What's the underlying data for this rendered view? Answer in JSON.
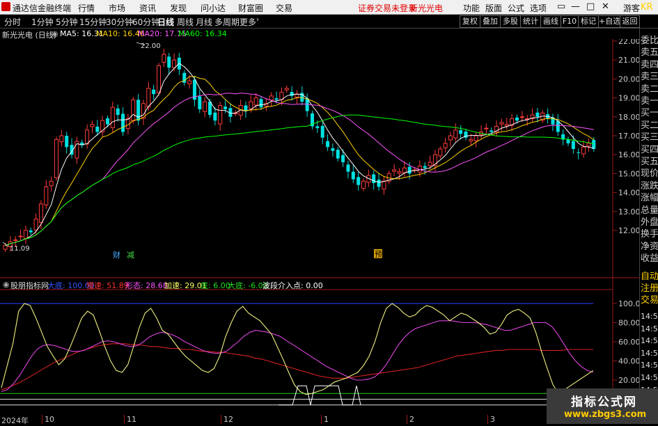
{
  "topbar": {
    "app_title": "通达信金融终端",
    "menus": [
      "行情",
      "市场",
      "资讯",
      "发现",
      "问小达",
      "财富圈",
      "交易"
    ],
    "notice": "证券交易未登录",
    "stock_name": "新光光电",
    "right_menus": [
      "功能",
      "版面",
      "公式",
      "选项"
    ],
    "user": "游客",
    "controls": [
      "▭",
      "—",
      "□",
      "✕"
    ]
  },
  "tabs": {
    "periods": [
      "分时",
      "1分钟",
      "5分钟",
      "15分钟",
      "30分钟",
      "60分钟",
      "日线",
      "周线",
      "月线",
      "多周期",
      "更多"
    ],
    "active": "日线",
    "buttons": [
      "复权",
      "叠加",
      "多股",
      "统计",
      "画线",
      "F10",
      "标记",
      "+自选",
      "返回"
    ]
  },
  "ma_line": {
    "title": "新光光电 (日线)",
    "ma5": "MA5: 16.31",
    "ma10": "MA10: 16.46",
    "ma20": "MA20: 17.15",
    "ma60": "MA60: 16.34",
    "colors": {
      "ma5": "#ffffff",
      "ma10": "#ffd200",
      "ma20": "#ff55ff",
      "ma60": "#00ff00"
    }
  },
  "price_axis": {
    "labels": [
      "22.00",
      "21.00",
      "20.00",
      "19.00",
      "18.00",
      "17.00",
      "16.00",
      "15.00",
      "14.00",
      "13.00",
      "12.00"
    ],
    "high_label": "22.00",
    "low_label": "11.09"
  },
  "markers": [
    "财",
    "减",
    "预"
  ],
  "indicator": {
    "name": "股朋指标网",
    "top": "大底: 100.00",
    "slow": "慢速: 51.89",
    "form": "形态: 28.68",
    "fast": "加速: 29.01",
    "bottom": "底: 6.00",
    "big_bottom": "大底: -6.00",
    "entry": "波段介入点: 0.00",
    "axis_labels": [
      "100.00",
      "80.00",
      "60.00",
      "40.00",
      "20.00"
    ]
  },
  "right_panel": {
    "items": [
      "委比",
      "卖五",
      "卖四",
      "卖三",
      "卖二",
      "卖一",
      "买一",
      "买二",
      "买三",
      "买四",
      "买五",
      "现价",
      "涨跌",
      "涨幅",
      "总量",
      "外盘",
      "换手",
      "净资",
      "收益"
    ],
    "tabs": [
      "自动",
      "注册",
      "交易"
    ],
    "times": [
      "14:5",
      "14:5",
      "14:5",
      "14:5",
      "14:5",
      "14:5",
      "14:5",
      "14:5",
      "14:5"
    ],
    "corner": "KR"
  },
  "x_axis": {
    "labels": [
      "2024年",
      "10",
      "11",
      "12",
      "1",
      "2",
      "3"
    ]
  },
  "watermark": {
    "title": "指标公式网",
    "url": "www.zbgs3.com"
  },
  "chart_data": {
    "type": "candlestick",
    "title": "新光光电 (日线)",
    "ylim": [
      11.0,
      22.5
    ],
    "y_ticks": [
      12,
      13,
      14,
      15,
      16,
      17,
      18,
      19,
      20,
      21,
      22
    ],
    "annotations": [
      {
        "label": "22.00",
        "value": 22.0
      },
      {
        "label": "11.09",
        "value": 11.09
      }
    ],
    "series": [
      {
        "name": "MA5",
        "values": [
          16.31
        ]
      },
      {
        "name": "MA10",
        "values": [
          16.46
        ]
      },
      {
        "name": "MA20",
        "values": [
          17.15
        ]
      },
      {
        "name": "MA60",
        "values": [
          16.34
        ]
      }
    ],
    "indicator_ylim": [
      0,
      110
    ],
    "indicator_ticks": [
      20,
      40,
      60,
      80,
      100
    ]
  }
}
